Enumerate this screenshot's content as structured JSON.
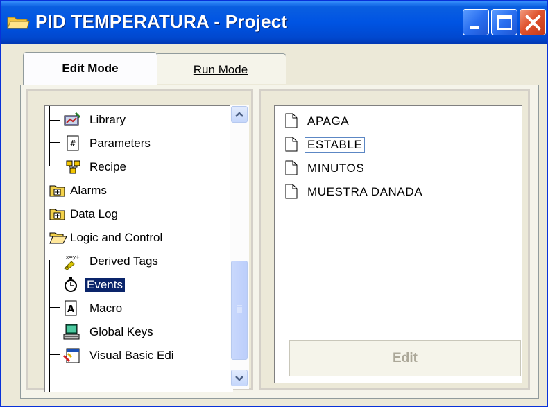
{
  "window": {
    "title": "PID TEMPERATURA - Project",
    "icon": "folder-icon",
    "controls": [
      "minimize-icon",
      "maximize-icon",
      "close-icon"
    ]
  },
  "tabs": [
    {
      "label": "Edit Mode",
      "active": true
    },
    {
      "label": "Run Mode",
      "active": false
    }
  ],
  "tree": {
    "items": [
      {
        "label": "Library",
        "icon": "library-icon",
        "level": 2
      },
      {
        "label": "Parameters",
        "icon": "parameters-icon",
        "level": 2
      },
      {
        "label": "Recipe",
        "icon": "recipe-icon",
        "level": 2
      },
      {
        "label": "Alarms",
        "icon": "folder-plus-icon",
        "level": 1
      },
      {
        "label": "Data Log",
        "icon": "folder-plus-icon",
        "level": 1
      },
      {
        "label": "Logic and Control",
        "icon": "folder-open-icon",
        "level": 1
      },
      {
        "label": "Derived Tags",
        "icon": "derived-tags-icon",
        "level": 2
      },
      {
        "label": "Events",
        "icon": "stopwatch-icon",
        "level": 2,
        "selected": true
      },
      {
        "label": "Macro",
        "icon": "macro-icon",
        "level": 2
      },
      {
        "label": "Global Keys",
        "icon": "global-keys-icon",
        "level": 2
      },
      {
        "label": "Visual Basic Edi",
        "icon": "visual-basic-icon",
        "level": 2
      }
    ]
  },
  "list": {
    "items": [
      {
        "label": "APAGA",
        "icon": "document-icon"
      },
      {
        "label": "ESTABLE",
        "icon": "document-icon",
        "focused": true
      },
      {
        "label": "MINUTOS",
        "icon": "document-icon"
      },
      {
        "label": "MUESTRA DANADA",
        "icon": "document-icon"
      }
    ],
    "edit_button": "Edit"
  },
  "colors": {
    "titlebar": "#0054e3",
    "selection": "#0a246a",
    "disabled_text": "#aca899"
  }
}
